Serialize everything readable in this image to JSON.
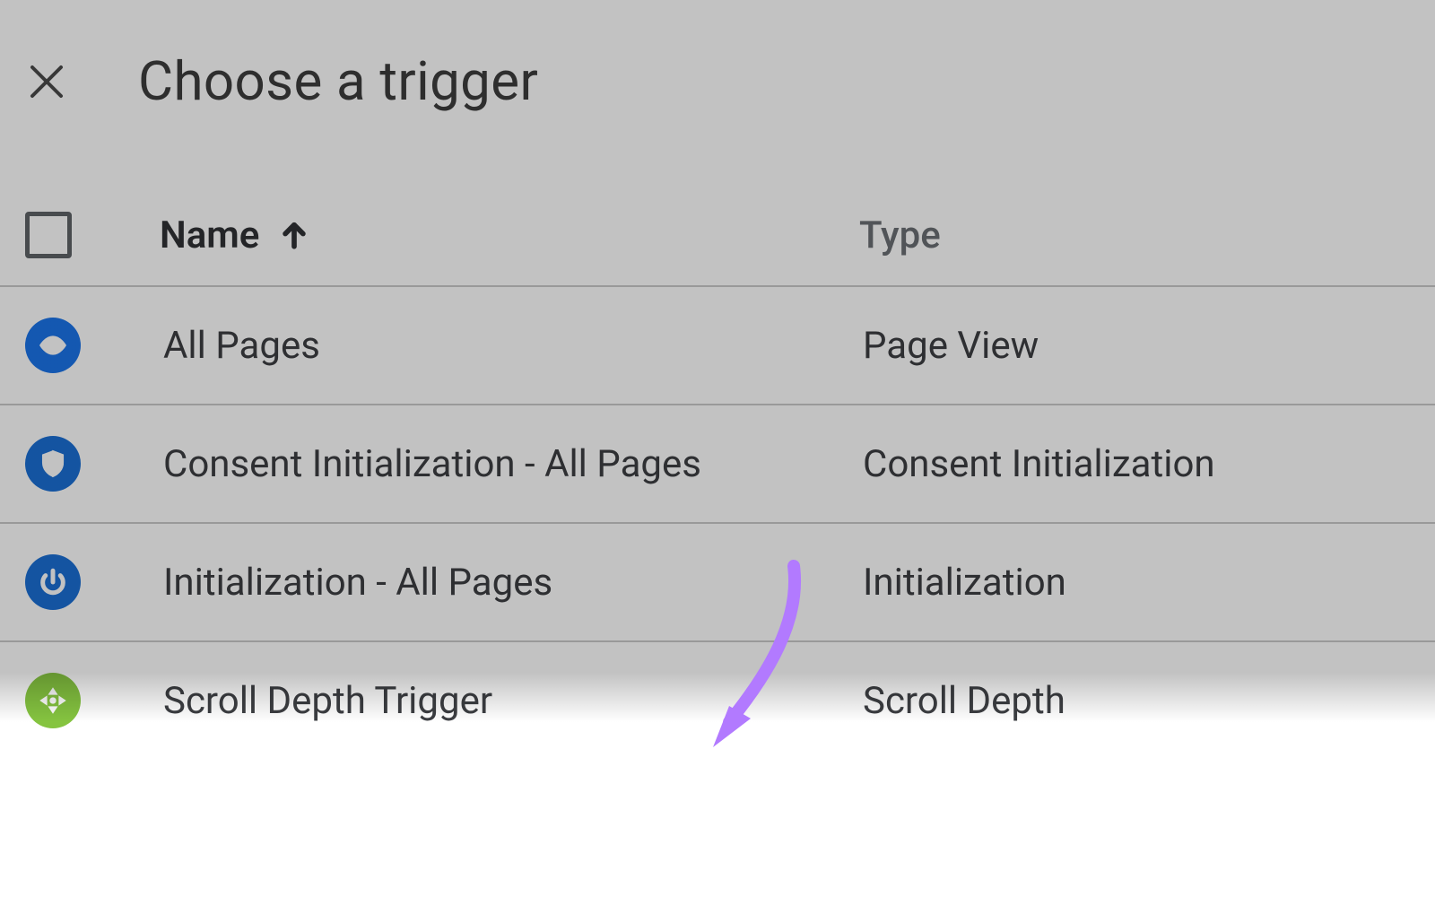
{
  "header": {
    "title": "Choose a trigger"
  },
  "table": {
    "columns": {
      "name": "Name",
      "type": "Type"
    },
    "rows": [
      {
        "icon": "eye-icon",
        "name": "All Pages",
        "type": "Page View"
      },
      {
        "icon": "shield-icon",
        "name": "Consent Initialization - All Pages",
        "type": "Consent Initialization"
      },
      {
        "icon": "power-icon",
        "name": "Initialization - All Pages",
        "type": "Initialization"
      },
      {
        "icon": "scroll-icon",
        "name": "Scroll Depth Trigger",
        "type": "Scroll Depth"
      }
    ]
  }
}
